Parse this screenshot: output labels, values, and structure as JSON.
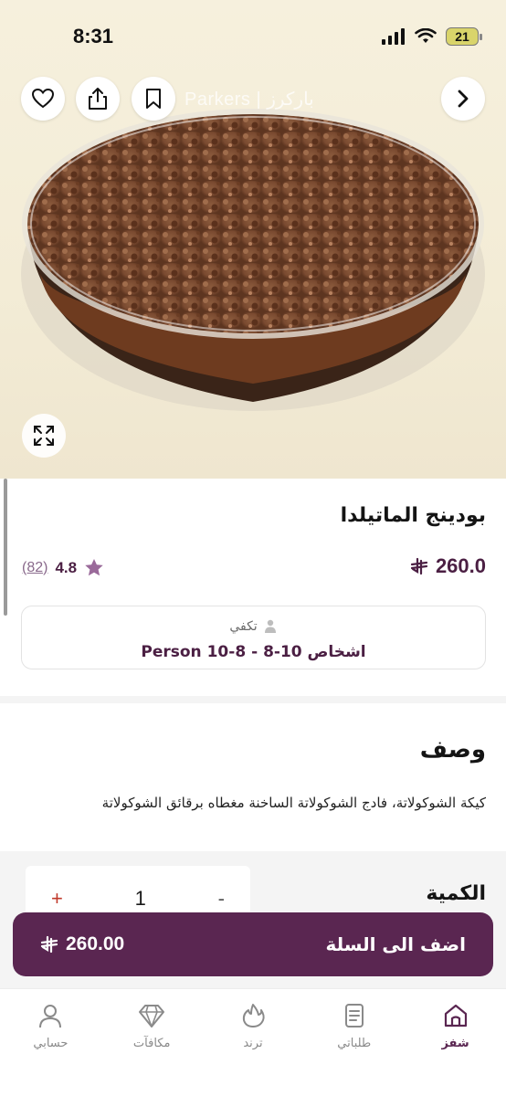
{
  "status_bar": {
    "time": "8:31",
    "battery": "21",
    "icons": [
      "cellular-signal-icon",
      "wifi-icon",
      "battery-icon"
    ]
  },
  "header": {
    "brand_watermark": "Parkers | باركرز",
    "buttons": [
      "favorite-heart-icon",
      "share-icon",
      "bookmark-icon",
      "next-chevron-icon"
    ]
  },
  "hero": {
    "expand_icon": "expand-arrows-icon"
  },
  "product": {
    "name": "بودينج الماتيلدا",
    "price": "260.0",
    "currency_symbol": "riyal-icon",
    "rating": "4.8",
    "rating_count": "(82)",
    "serves_label": "تكفي",
    "serves_value": "اشخاص 10-8 - 8-10 Person"
  },
  "description": {
    "title": "وصف",
    "text": "كيكة الشوكولاتة، فادج الشوكولاتة الساخنة مغطاه برقائق الشوكولاتة"
  },
  "quantity": {
    "label": "الكمية",
    "minus": "-",
    "value": "1",
    "plus": "+"
  },
  "cart": {
    "label": "اضف الى السلة",
    "price": "260.00"
  },
  "tab_bar": {
    "items": [
      {
        "label": "شفز",
        "icon": "home-icon"
      },
      {
        "label": "طلباتي",
        "icon": "orders-document-icon"
      },
      {
        "label": "ترند",
        "icon": "flame-icon"
      },
      {
        "label": "مكافآت",
        "icon": "diamond-icon"
      },
      {
        "label": "حسابي",
        "icon": "user-icon"
      }
    ],
    "active_color": "#5a2651"
  },
  "colors": {
    "brand": "#5a2651",
    "price": "#4b1f43",
    "rating_star": "#9a6a9a",
    "plus": "#c0392b"
  }
}
